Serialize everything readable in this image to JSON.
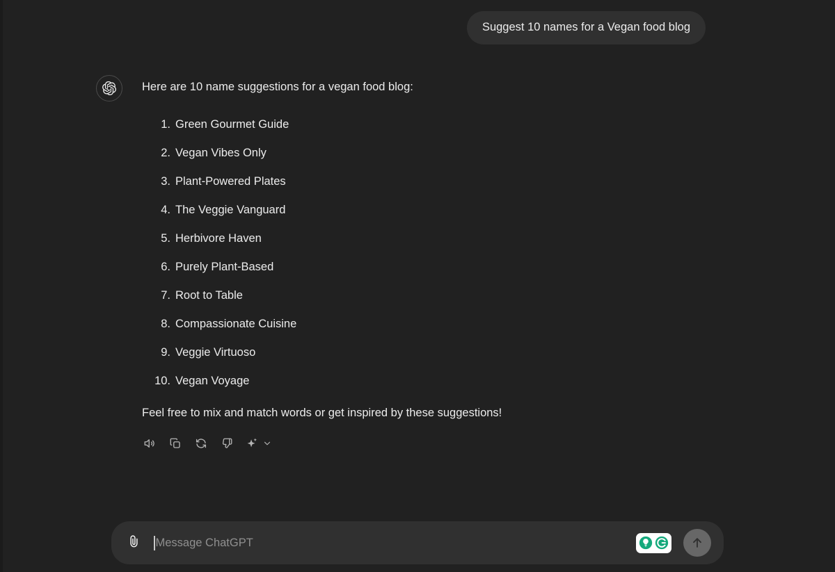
{
  "app": {
    "title": "ChatGPT",
    "background_color": "#212121"
  },
  "conversation": {
    "user_message": {
      "text": "Suggest 10 names for a Vegan food blog",
      "bubble_color": "#303030"
    },
    "assistant_message": {
      "avatar_icon": "openai-logo-icon",
      "intro": "Here are 10 name suggestions for a vegan food blog:",
      "list": [
        {
          "number": "1.",
          "label": "Green Gourmet Guide"
        },
        {
          "number": "2.",
          "label": "Vegan Vibes Only"
        },
        {
          "number": "3.",
          "label": "Plant-Powered Plates"
        },
        {
          "number": "4.",
          "label": "The Veggie Vanguard"
        },
        {
          "number": "5.",
          "label": "Herbivore Haven"
        },
        {
          "number": "6.",
          "label": "Purely Plant-Based"
        },
        {
          "number": "7.",
          "label": "Root to Table"
        },
        {
          "number": "8.",
          "label": "Compassionate Cuisine"
        },
        {
          "number": "9.",
          "label": "Veggie Virtuoso"
        },
        {
          "number": "10.",
          "label": "Vegan Voyage"
        }
      ],
      "outro": "Feel free to mix and match words or get inspired by these suggestions!",
      "actions": [
        {
          "name": "read-aloud",
          "icon": "speaker-icon"
        },
        {
          "name": "copy",
          "icon": "copy-icon"
        },
        {
          "name": "regenerate",
          "icon": "refresh-icon"
        },
        {
          "name": "dislike",
          "icon": "thumbs-down-icon"
        },
        {
          "name": "model-switch",
          "icon": "sparkles-icon",
          "chevron": "chevron-down-icon"
        }
      ]
    }
  },
  "composer": {
    "attach_icon": "paperclip-icon",
    "placeholder": "Message ChatGPT",
    "value": "",
    "extension_badge": {
      "name": "grammarly-badge",
      "icons": [
        "lightbulb-icon",
        "grammarly-g-icon"
      ],
      "background": "#ffffff",
      "accent": "#15a97c"
    },
    "send_button": {
      "icon": "arrow-up-icon",
      "background": "#676767"
    }
  }
}
